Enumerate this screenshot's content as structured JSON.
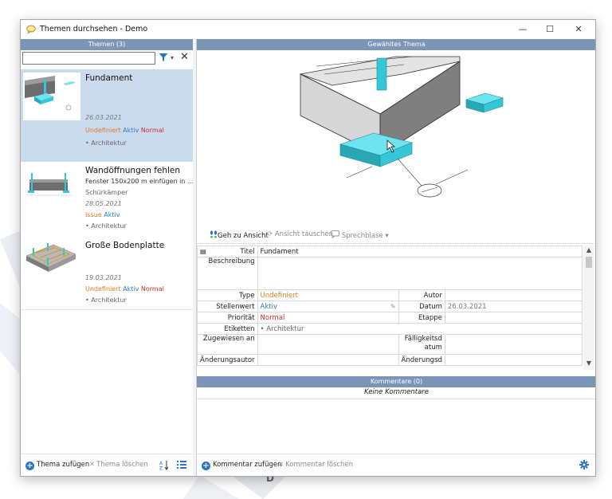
{
  "window": {
    "title": "Themen durchsehen - Demo",
    "minimize": "—",
    "maximize": "☐",
    "close": "✕"
  },
  "left_panel": {
    "header": "Themen (3)",
    "search": {
      "value": "",
      "placeholder": ""
    },
    "topics": [
      {
        "title": "Fundament",
        "description": "",
        "author": "",
        "date": "26.03.2021",
        "type": "Undefiniert",
        "status": "Aktiv",
        "priority": "Normal",
        "label": "• Architektur",
        "selected": true
      },
      {
        "title": "Wandöffnungen fehlen",
        "description": "Fenster 150x200 m einfügen in ...",
        "author": "Schürkämper",
        "date": "28.05.2021",
        "type": "Issue",
        "status": "Aktiv",
        "priority": "",
        "label": "• Architektur",
        "selected": false
      },
      {
        "title": "Große Bodenplatte",
        "description": "",
        "author": "",
        "date": "19.03.2021",
        "type": "Undefiniert",
        "status": "Aktiv",
        "priority": "Normal",
        "label": "• Architektur",
        "selected": false
      }
    ],
    "toolbar": {
      "add_topic": "Thema zufügen",
      "delete_topic": "Thema löschen"
    }
  },
  "right_panel": {
    "header": "Gewähltes Thema",
    "view_toolbar": {
      "goto_view": "Geh zu Ansicht",
      "swap_view": "Ansicht tauschen",
      "speech_bubble": "Sprechblase"
    },
    "properties": {
      "title_label": "Titel",
      "title_value": "Fundament",
      "description_label": "Beschreibung",
      "description_value": "",
      "type_label": "Type",
      "type_value": "Undefiniert",
      "author_label": "Autor",
      "author_value": "",
      "status_label": "Stellenwert",
      "status_value": "Aktiv",
      "date_label": "Datum",
      "date_value": "26.03.2021",
      "priority_label": "Priorität",
      "priority_value": "Normal",
      "stage_label": "Etappe",
      "stage_value": "",
      "labels_label": "Etiketten",
      "labels_value": "• Architektur",
      "assigned_label": "Zugewiesen an",
      "assigned_value": "",
      "due_label": "Fälligkeitsdatum",
      "due_value": "",
      "modified_author_label": "Änderungsautor",
      "modified_date_label": "Änderungsd"
    },
    "comments": {
      "header": "Kommentare (0)",
      "empty": "Keine Kommentare"
    },
    "toolbar": {
      "add_comment": "Kommentar zufügen",
      "delete_comment": "Kommentar löschen"
    }
  },
  "colors": {
    "header_bg": "#7b95b7",
    "selection_bg": "#ccdaee",
    "accent_blue": "#2b73c4",
    "undefined_orange": "#e07a1f",
    "active_blue": "#2a7fc2",
    "normal_red": "#d42b2b",
    "cyan_model": "#35c7d6"
  },
  "icons": {
    "app": "speech-bubble-icon",
    "filter": "filter-icon",
    "clear": "close-icon",
    "sort": "sort-az-icon",
    "list": "list-icon",
    "goto": "footprints-icon",
    "swap": "refresh-icon",
    "bubble": "speech-bubble-icon",
    "settings": "gear-icon"
  }
}
